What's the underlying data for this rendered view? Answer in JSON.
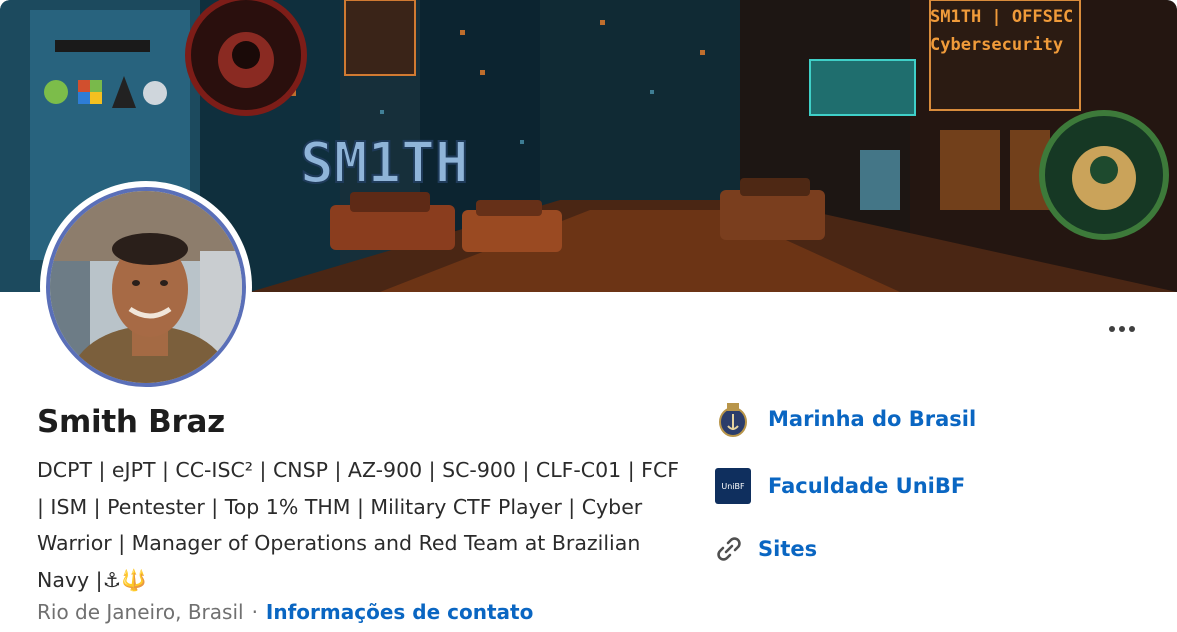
{
  "banner": {
    "title_text": "SM1TH",
    "corner_line1": "SM1TH | OFFSEC",
    "corner_line2": "Cybersecurity"
  },
  "profile": {
    "name": "Smith Braz",
    "headline": "DCPT | eJPT | CC-ISC² | CNSP | AZ-900 | SC-900 | CLF-C01 | FCF | ISM | Pentester | Top 1% THM | Military CTF Player | Cyber Warrior | Manager of Operations and Red Team at Brazilian Navy |⚓🔱",
    "location": "Rio de Janeiro, Brasil",
    "separator": "·",
    "contact_link": "Informações de contato"
  },
  "organizations": [
    {
      "label": "Marinha do Brasil",
      "icon": "navy-crest-icon"
    },
    {
      "label": "Faculdade UniBF",
      "icon": "unibf-logo-icon",
      "logo_text": "UniBF"
    },
    {
      "label": "Sites",
      "icon": "link-icon"
    }
  ],
  "more_button": {
    "icon": "more-options-icon"
  },
  "colors": {
    "accent": "#0a66c2",
    "avatar_ring": "#5a6fb8",
    "banner_neon": "#8fb4d8"
  }
}
